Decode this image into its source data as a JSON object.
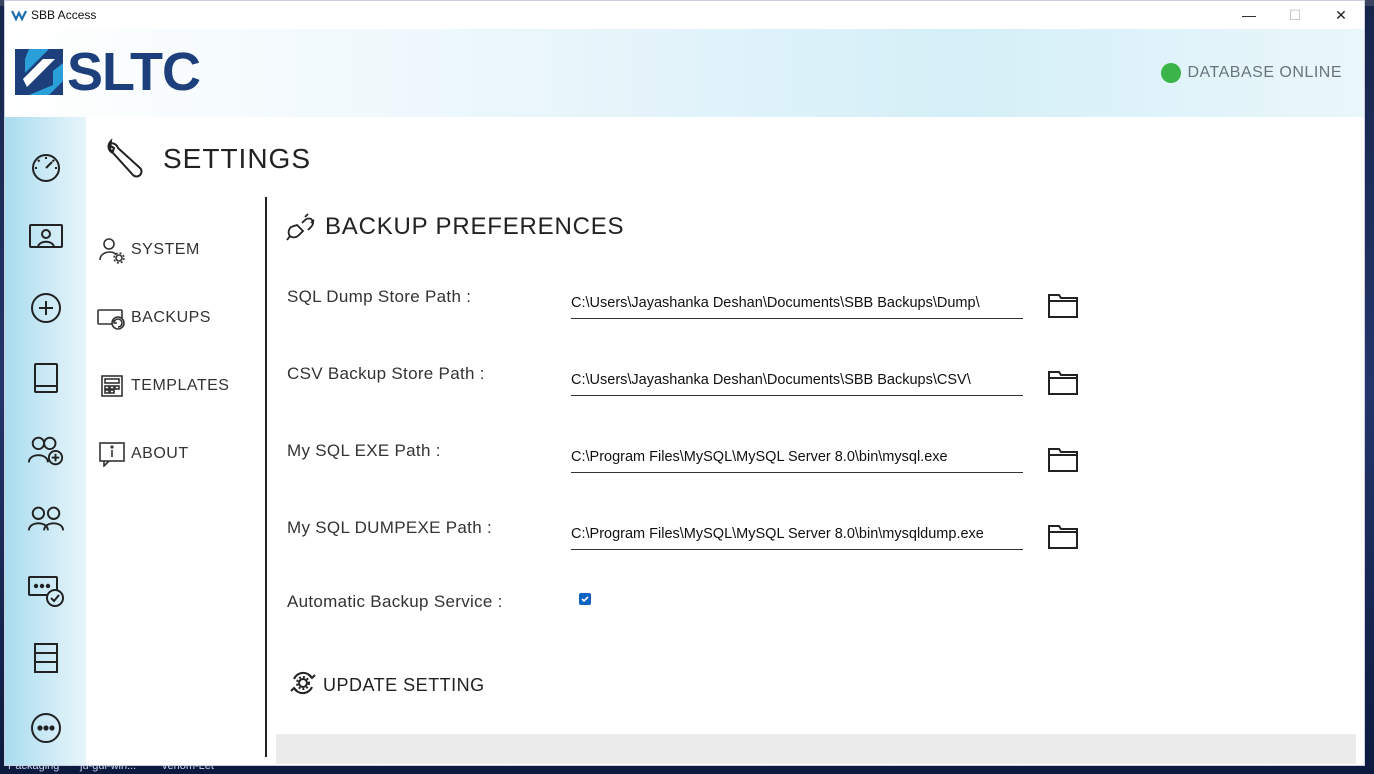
{
  "window": {
    "title": "SBB Access",
    "minimize": "—",
    "maximize": "☐",
    "close": "✕"
  },
  "header": {
    "logo_text": "SLTC",
    "db_status": "DATABASE ONLINE",
    "db_status_color": "#3bb54a"
  },
  "rail": {
    "icons": [
      "dashboard-gauge-icon",
      "presentation-user-icon",
      "add-circle-icon",
      "book-icon",
      "add-group-icon",
      "group-icon",
      "message-check-icon",
      "list-rows-icon",
      "more-icon"
    ]
  },
  "settings": {
    "title": "SETTINGS"
  },
  "submenu": {
    "items": [
      {
        "label": "SYSTEM",
        "icon": "user-gear-icon"
      },
      {
        "label": "BACKUPS",
        "icon": "backup-restore-icon"
      },
      {
        "label": "TEMPLATES",
        "icon": "template-grid-icon"
      },
      {
        "label": "ABOUT",
        "icon": "info-board-icon"
      }
    ]
  },
  "backup": {
    "title": "BACKUP PREFERENCES",
    "fields": [
      {
        "label": "SQL Dump Store Path :",
        "value": "C:\\Users\\Jayashanka Deshan\\Documents\\SBB Backups\\Dump\\"
      },
      {
        "label": "CSV Backup Store Path :",
        "value": "C:\\Users\\Jayashanka Deshan\\Documents\\SBB Backups\\CSV\\"
      },
      {
        "label": "My SQL EXE Path :",
        "value": "C:\\Program Files\\MySQL\\MySQL Server 8.0\\bin\\mysql.exe"
      },
      {
        "label": "My SQL DUMPEXE Path :",
        "value": "C:\\Program Files\\MySQL\\MySQL Server 8.0\\bin\\mysqldump.exe"
      }
    ],
    "auto_backup_label": "Automatic Backup Service  :",
    "auto_backup_checked": true,
    "update_label": "UPDATE SETTING"
  },
  "taskbar": {
    "labels": [
      "Packaging",
      "ju-gui-win...",
      "venom-Let"
    ]
  }
}
